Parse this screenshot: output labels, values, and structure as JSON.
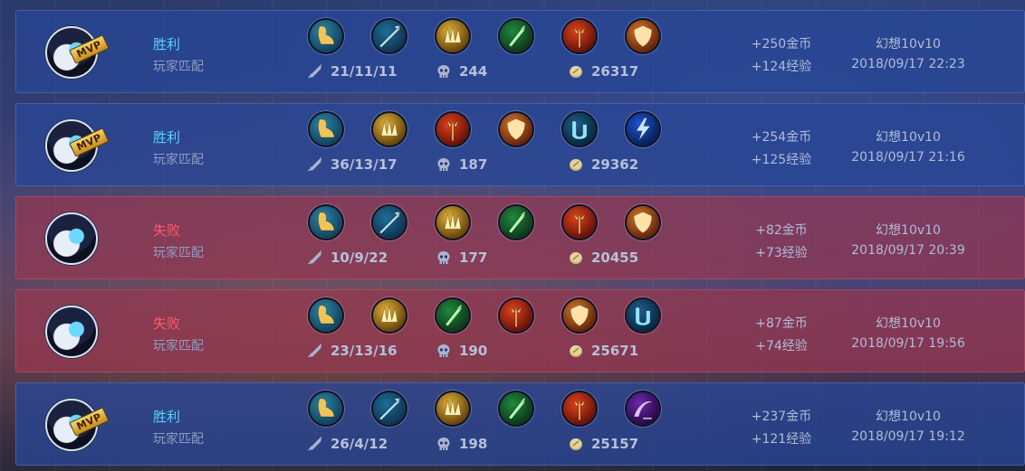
{
  "matches": [
    {
      "outcome": "win",
      "result": "胜利",
      "mode": "玩家匹配",
      "mvp": true,
      "mvp_label": "MVP",
      "items": [
        "boots-icon",
        "spear-icon",
        "gold-claw-icon",
        "green-blade-icon",
        "fire-trident-icon",
        "shield-icon"
      ],
      "kda": "21/11/11",
      "last_hits": "244",
      "gold": "26317",
      "reward_gold": "+250金币",
      "reward_exp": "+124经验",
      "game": "幻想10v10",
      "time": "2018/09/17 22:23"
    },
    {
      "outcome": "win",
      "result": "胜利",
      "mode": "玩家匹配",
      "mvp": true,
      "mvp_label": "MVP",
      "items": [
        "boots-icon",
        "gold-claw-icon",
        "fire-trident-icon",
        "shield-icon",
        "blue-scroll-icon",
        "lightning-blade-icon"
      ],
      "kda": "36/13/17",
      "last_hits": "187",
      "gold": "29362",
      "reward_gold": "+254金币",
      "reward_exp": "+125经验",
      "game": "幻想10v10",
      "time": "2018/09/17 21:16"
    },
    {
      "outcome": "loss",
      "result": "失败",
      "mode": "玩家匹配",
      "mvp": false,
      "mvp_label": "",
      "items": [
        "boots-icon",
        "spear-icon",
        "gold-claw-icon",
        "green-blade-icon",
        "fire-trident-icon",
        "shield-icon"
      ],
      "kda": "10/9/22",
      "last_hits": "177",
      "gold": "20455",
      "reward_gold": "+82金币",
      "reward_exp": "+73经验",
      "game": "幻想10v10",
      "time": "2018/09/17 20:39"
    },
    {
      "outcome": "loss",
      "result": "失败",
      "mode": "玩家匹配",
      "mvp": false,
      "mvp_label": "",
      "items": [
        "boots-icon",
        "gold-claw-icon",
        "green-blade-icon",
        "fire-trident-icon",
        "shield-icon",
        "blue-scroll-icon"
      ],
      "kda": "23/13/16",
      "last_hits": "190",
      "gold": "25671",
      "reward_gold": "+87金币",
      "reward_exp": "+74经验",
      "game": "幻想10v10",
      "time": "2018/09/17 19:56"
    },
    {
      "outcome": "win",
      "result": "胜利",
      "mode": "玩家匹配",
      "mvp": true,
      "mvp_label": "MVP",
      "items": [
        "boots-icon",
        "spear-icon",
        "gold-claw-icon",
        "green-blade-icon",
        "fire-trident-icon",
        "purple-scythe-icon"
      ],
      "kda": "26/4/12",
      "last_hits": "198",
      "gold": "25157",
      "reward_gold": "+237金币",
      "reward_exp": "+121经验",
      "game": "幻想10v10",
      "time": "2018/09/17 19:12"
    }
  ]
}
